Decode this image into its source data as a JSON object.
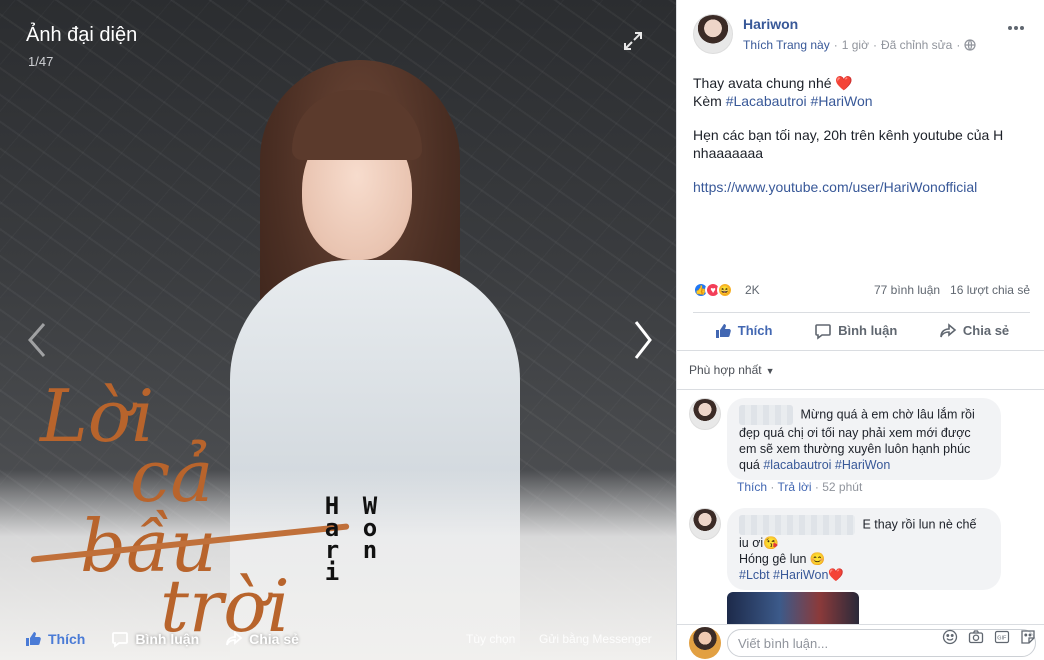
{
  "viewer": {
    "title": "Ảnh đại diện",
    "counter": "1/47",
    "art_title_words": [
      "Lời",
      "cả",
      "bầu",
      "trời"
    ],
    "name_col1": [
      "H",
      "a",
      "r",
      "i"
    ],
    "name_col2": [
      "W",
      "o",
      "n"
    ],
    "like_label": "Thích",
    "comment_label": "Bình luận",
    "share_label": "Chia sẻ",
    "options_label": "Tùy chọn",
    "send_label": "Gửi bằng Messenger"
  },
  "post": {
    "author": "Hariwon",
    "follow_label": "Thích Trang này",
    "dot": "·",
    "time": "1 giờ",
    "edited": "Đã chỉnh sửa",
    "line1": "Thay avata chung nhé ❤️",
    "line2_prefix": "Kèm",
    "hashtag1": "#Lacabautroi",
    "hashtag2": "#HariWon",
    "line3": "Hẹn các bạn tối nay, 20h trên kênh youtube của H nhaaaaaaa",
    "link": "https://www.youtube.com/user/HariWonofficial"
  },
  "reactions": {
    "count": "2K",
    "comments": "77 bình luận",
    "shares": "16 lượt chia sẻ"
  },
  "actions": {
    "like": "Thích",
    "comment": "Bình luận",
    "share": "Chia sẻ"
  },
  "sort": {
    "label": "Phù hợp nhất"
  },
  "comments": [
    {
      "text": "Mừng quá à em chờ lâu lắm rồi đẹp quá chị ơi tối nay phải xem mới được em sẽ xem thường xuyên luôn hạnh phúc quá",
      "tags": "#lacabautroi #HariWon",
      "like": "Thích",
      "reply": "Trả lời",
      "time": "52 phút"
    },
    {
      "line1": "E thay rồi lun nè chế iu ơi😘",
      "line2": "Hóng gê lun 😊",
      "tags": "#Lcbt #HariWon❤️"
    }
  ],
  "composer": {
    "placeholder": "Viết bình luận..."
  },
  "colors": {
    "link": "#385898",
    "like_blue": "#4267b2",
    "heart": "#e0245e"
  }
}
